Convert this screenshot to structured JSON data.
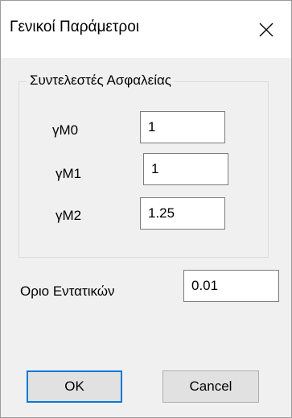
{
  "window": {
    "title": "Γενικοί Παράμετροι",
    "close_icon": "close-icon"
  },
  "safety_factors": {
    "legend": "Συντελεστές Ασφαλείας",
    "fields": [
      {
        "label": "γM0",
        "value": "1"
      },
      {
        "label": "γM1",
        "value": "1"
      },
      {
        "label": "γM2",
        "value": "1.25"
      }
    ]
  },
  "limit": {
    "label": "Οριο Εντατικών",
    "value": "0.01"
  },
  "buttons": {
    "ok_label": "OK",
    "cancel_label": "Cancel"
  },
  "colors": {
    "default_button_border": "#0078d7",
    "dialog_background": "#f0f0f0"
  }
}
